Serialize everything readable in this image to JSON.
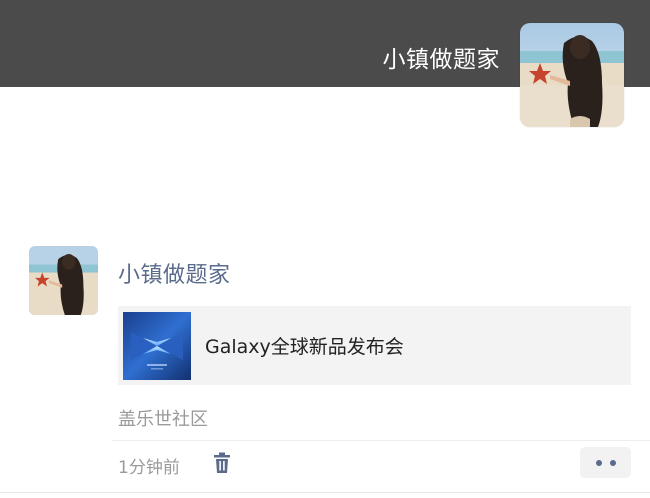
{
  "header": {
    "username": "小镇做题家",
    "cover_color": "#4b4b4b"
  },
  "post": {
    "author": "小镇做题家",
    "link_card": {
      "title": "Galaxy全球新品发布会",
      "thumbnail_icon": "galaxy-event-thumbnail"
    },
    "source": "盖乐世社区",
    "time": "1分钟前",
    "delete_icon": "trash-icon",
    "more_icon": "two-dots-icon"
  },
  "colors": {
    "author_name": "#5b6b8c",
    "secondary_text": "#9a9a9a",
    "card_bg": "#f3f3f3"
  }
}
